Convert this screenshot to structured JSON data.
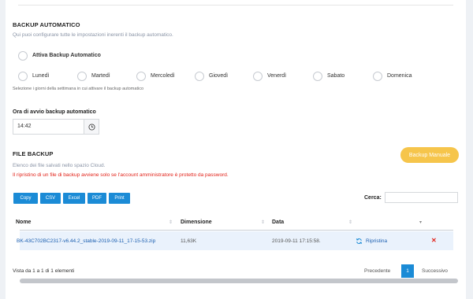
{
  "backup": {
    "title": "BACKUP AUTOMATICO",
    "description": "Qui puoi configurare tutte le impostazioni inerenti il backup automatico.",
    "enable_label": "Attiva Backup Automatico",
    "days": [
      "Lunedì",
      "Martedì",
      "Mercoledì",
      "Giovedì",
      "Venerdì",
      "Sabato",
      "Domenica"
    ],
    "days_help": "Selezione i giorni della settimana in cui attivare il backup automatico",
    "time_label": "Ora di avvio backup automatico",
    "time_value": "14:42"
  },
  "files": {
    "title": "FILE BACKUP",
    "description": "Elenco dei file salvati nello spazio Cloud.",
    "warning": "Il ripristino di un file di backup avviene solo se l'account amministratore è protetto da password.",
    "manual_button": "Backup Manuale",
    "export_buttons": [
      "Copy",
      "CSV",
      "Excel",
      "PDF",
      "Print"
    ],
    "search_label": "Cerca:",
    "search_value": "",
    "columns": [
      "Nome",
      "Dimensione",
      "Data"
    ],
    "rows": [
      {
        "name": "BK-43C702BC2317-v6.44.2_stable-2019-09-11_17-15-53.zip",
        "size": "11,63K",
        "date": "2019-09-11 17:15:58.",
        "action": "Ripristina"
      }
    ],
    "info": "Vista da 1 a 1 di 1 elementi",
    "pagination": {
      "prev": "Precedente",
      "current": "1",
      "next": "Successivo"
    }
  },
  "colors": {
    "accent_blue": "#1b8bd6",
    "button_orange": "#f6c54b",
    "warning_red": "#e2231a",
    "row_highlight": "#eaf2fc"
  },
  "icons": {
    "clock": "clock-icon",
    "restore": "refresh-icon",
    "delete": "close-icon",
    "sort": "sort-arrows-icon"
  }
}
